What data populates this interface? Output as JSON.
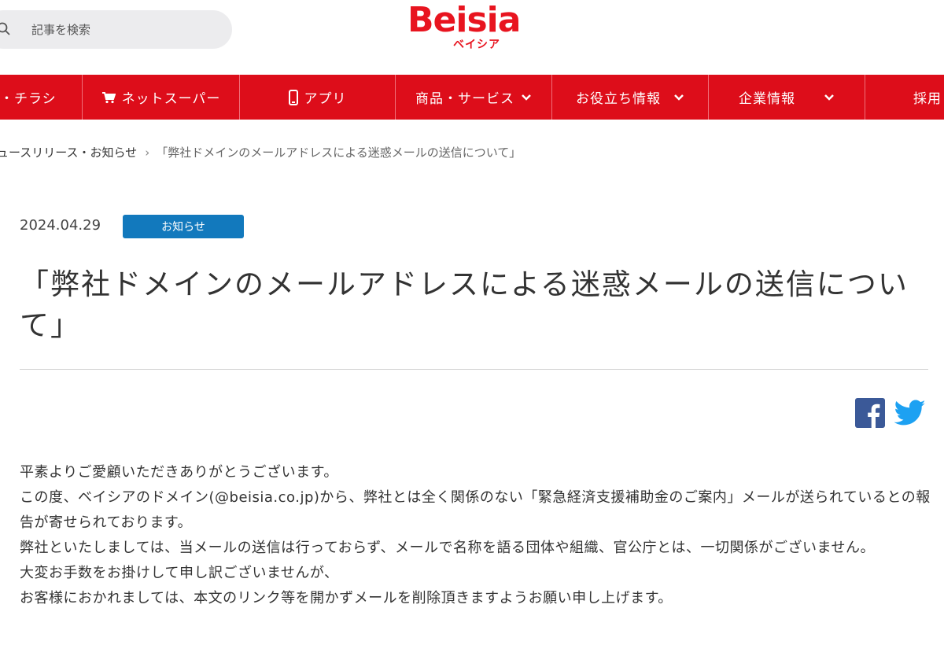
{
  "search": {
    "placeholder": "記事を検索"
  },
  "logo": {
    "wordmark": "Beisia",
    "kana": "ベイシア"
  },
  "nav": {
    "items": [
      {
        "label": "・チラシ",
        "icon": "flyer"
      },
      {
        "label": "ネットスーパー",
        "icon": "cart-icon"
      },
      {
        "label": "アプリ",
        "icon": "smartphone-icon"
      },
      {
        "label": "商品・サービス",
        "icon": "chevron-down-icon"
      },
      {
        "label": "お役立ち情報",
        "icon": "chevron-down-icon"
      },
      {
        "label": "企業情報",
        "icon": "chevron-down-icon"
      },
      {
        "label": "採用",
        "icon": ""
      }
    ]
  },
  "breadcrumb": {
    "parent": "ュースリリース・お知らせ",
    "separator": "›",
    "current": "「弊社ドメインのメールアドレスによる迷惑メールの送信について」"
  },
  "article": {
    "date": "2024.04.29",
    "category": "お知らせ",
    "title": "「弊社ドメインのメールアドレスによる迷惑メールの送信について」",
    "paragraphs": [
      "平素よりご愛顧いただきありがとうございます。",
      "この度、ベイシアのドメイン(@beisia.co.jp)から、弊社とは全く関係のない「緊急経済支援補助金のご案内」メールが送られているとの報告が寄せられております。",
      "弊社といたしましては、当メールの送信は行っておらず、メールで名称を語る団体や組織、官公庁とは、一切関係がございません。",
      "大変お手数をお掛けして申し訳ございませんが、",
      "お客様におかれましては、本文のリンク等を開かずメールを削除頂きますようお願い申し上げます。"
    ]
  },
  "share": {
    "facebook": "facebook-icon",
    "twitter": "twitter-icon"
  },
  "colors": {
    "brand_red": "#dd0d1a",
    "badge_blue": "#1279bd",
    "facebook_blue": "#3b5998",
    "twitter_blue": "#1da1f2"
  }
}
